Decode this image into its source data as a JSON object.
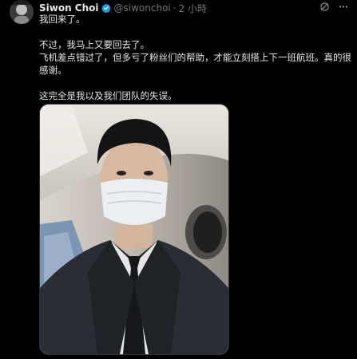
{
  "author": {
    "display_name": "Siwon Choi",
    "handle": "@siwonchoi",
    "separator": "·",
    "time": "2 小時",
    "verified_icon": "verified-badge-icon",
    "avatar_icon": "avatar"
  },
  "actions": {
    "grok_icon": "grok-icon",
    "more_icon": "more-options-icon"
  },
  "tweet": {
    "line1": "我回来了。",
    "line2": "不过，我马上又要回去了。",
    "line3": "飞机差点错过了，但多亏了粉丝们的帮助，才能立刻搭上下一班航班。真的很感谢。",
    "line4": "这完全是我以及我们团队的失误。"
  },
  "colors": {
    "background": "#000000",
    "text": "#e7e9ea",
    "muted": "#71767b",
    "verified": "#1d9bf0"
  }
}
